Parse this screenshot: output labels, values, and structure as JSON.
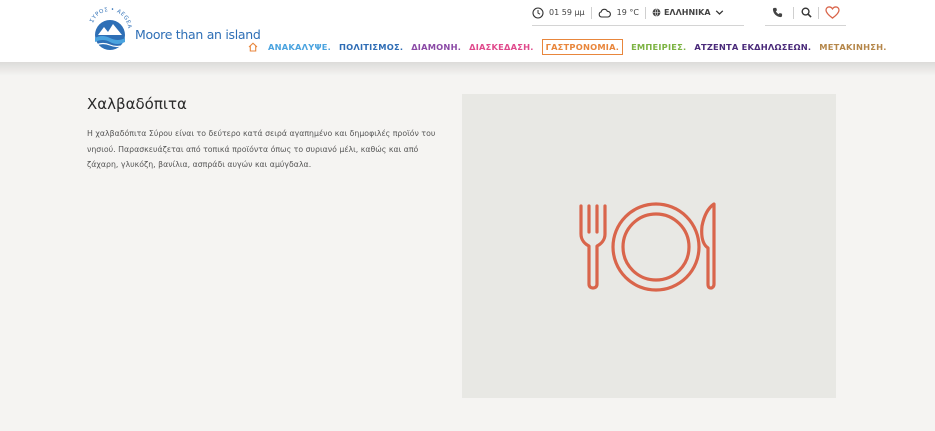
{
  "logo": {
    "tagline": "Moore than an island",
    "arc_text": "ΣΥΡΟΣ • AEGEAN SEA"
  },
  "topbar": {
    "time": "01 59 μμ",
    "temperature": "19 °C",
    "language": "ΕΛΛΗΝΙΚΑ",
    "icons": [
      "clock-icon",
      "cloud-icon",
      "globe-icon",
      "chevron-down-icon",
      "phone-icon",
      "search-icon",
      "heart-icon"
    ]
  },
  "nav": {
    "home_icon": "home-icon",
    "items": [
      {
        "label": "ΑΝΑΚΑΛΥΨΕ.",
        "color": "#4aa3df"
      },
      {
        "label": "ΠΟΛΙΤΙΣΜΟΣ.",
        "color": "#2f6db5"
      },
      {
        "label": "ΔΙΑΜΟΝΗ.",
        "color": "#8b4aa6"
      },
      {
        "label": "ΔΙΑΣΚΕΔΑΣΗ.",
        "color": "#e04a8c"
      },
      {
        "label": "ΓΑΣΤΡΟΝΟΜΙΑ.",
        "color": "#e8863c",
        "active": true
      },
      {
        "label": "ΕΜΠΕΙΡΙΕΣ.",
        "color": "#7cb342"
      },
      {
        "label": "ΑΤΖΕΝΤΑ ΕΚΔΗΛΩΣΕΩΝ.",
        "color": "#4a2a7a"
      },
      {
        "label": "ΜΕΤΑΚΙΝΗΣΗ.",
        "color": "#b5874a"
      }
    ]
  },
  "content": {
    "title": "Χαλβαδόπιτα",
    "description": "Η χαλβαδόπιτα Σύρου είναι το δεύτερο κατά σειρά αγαπημένο και δημοφιλές προϊόν του νησιού. Παρασκευάζεται από τοπικά προϊόντα όπως το συριανό μέλι, καθώς και από ζάχαρη, γλυκόζη, βανίλια, ασπράδι αυγών και αμύγδαλα."
  },
  "media": {
    "icon": "cutlery-plate-icon",
    "icon_color": "#d9654b",
    "background": "#e8e8e4"
  },
  "colors": {
    "accent": "#e8863c",
    "brand_blue": "#2e6fb6"
  }
}
